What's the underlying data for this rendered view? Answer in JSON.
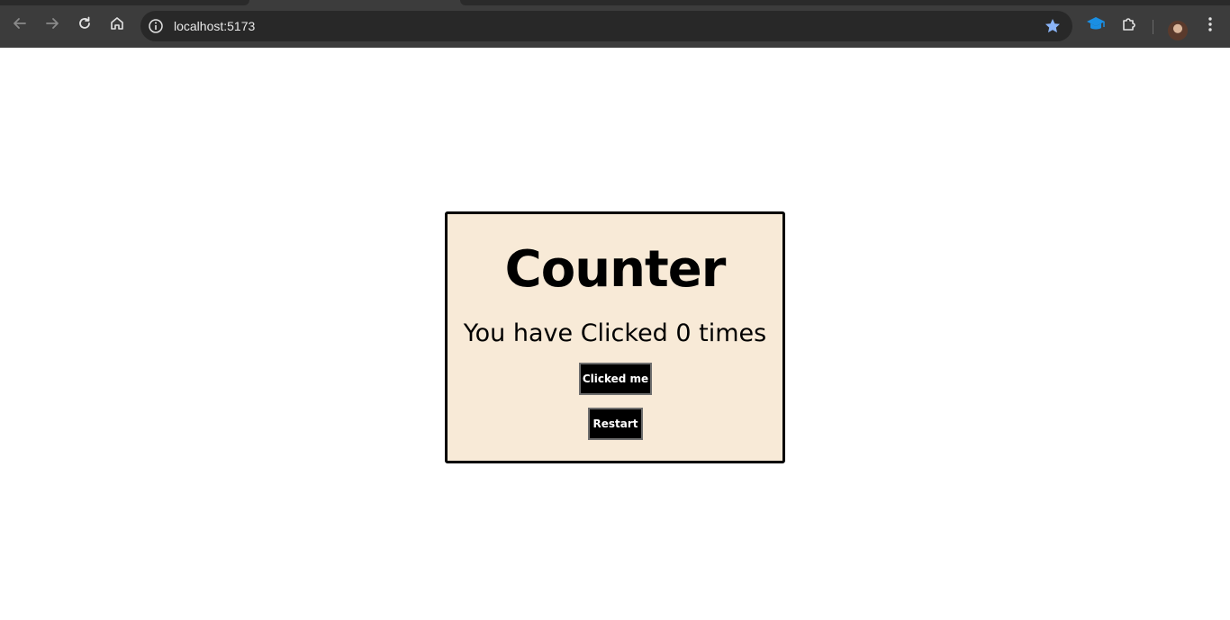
{
  "browser": {
    "url": "localhost:5173",
    "icons": {
      "back": "arrow-left-icon",
      "forward": "arrow-right-icon",
      "reload": "reload-icon",
      "home": "home-icon",
      "site_info": "info-icon",
      "bookmark": "star-icon",
      "extension_1": "graduation-cap-icon",
      "extensions": "puzzle-icon",
      "profile": "avatar",
      "menu": "kebab-menu-icon"
    },
    "colors": {
      "toolbar": "#3c3c3c",
      "omnibox": "#282828",
      "star": "#8ab4f8",
      "extension_accent": "#1a8fe3"
    }
  },
  "page": {
    "title": "Counter",
    "message": "You have Clicked 0 times",
    "click_button_label": "Clicked me",
    "restart_button_label": "Restart",
    "colors": {
      "card_background": "#f8ead7",
      "card_border": "#000000",
      "button_background": "#000000",
      "button_text": "#ffffff"
    }
  }
}
